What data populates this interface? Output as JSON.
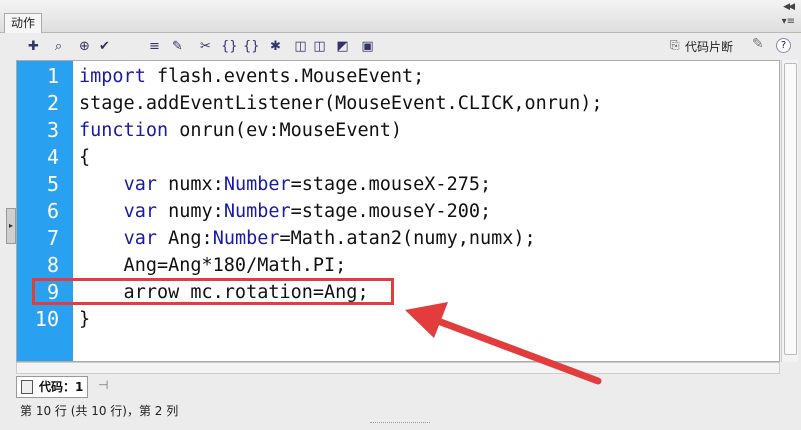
{
  "panel": {
    "tab_label": "动作"
  },
  "toolbar": {
    "icons": [
      "add-script-item-icon",
      "find-icon",
      "target-icon",
      "check-syntax-icon",
      "auto-format-icon",
      "code-hint-icon",
      "debug-options-icon",
      "collapse-braces-icon",
      "collapse-selection-icon",
      "expand-all-icon",
      "apply-block-comment-icon",
      "apply-line-comment-icon",
      "remove-comment-icon",
      "show-hide-toolbox-icon"
    ],
    "snippet_label": "代码片断"
  },
  "editor": {
    "line_numbers": [
      "1",
      "2",
      "3",
      "4",
      "5",
      "6",
      "7",
      "8",
      "9",
      "10"
    ],
    "lines": [
      [
        {
          "t": "import",
          "c": "kw"
        },
        {
          "t": " flash.events.MouseEvent;",
          "c": ""
        }
      ],
      [
        {
          "t": "stage.addEventListener(MouseEvent.CLICK,onrun);",
          "c": ""
        }
      ],
      [
        {
          "t": "function",
          "c": "kw"
        },
        {
          "t": " onrun(ev:MouseEvent)",
          "c": ""
        }
      ],
      [
        {
          "t": "{",
          "c": ""
        }
      ],
      [
        {
          "t": "    ",
          "c": ""
        },
        {
          "t": "var",
          "c": "kw"
        },
        {
          "t": " numx:",
          "c": ""
        },
        {
          "t": "Number",
          "c": "ty"
        },
        {
          "t": "=stage.mouseX-275;",
          "c": ""
        }
      ],
      [
        {
          "t": "    ",
          "c": ""
        },
        {
          "t": "var",
          "c": "kw"
        },
        {
          "t": " numy:",
          "c": ""
        },
        {
          "t": "Number",
          "c": "ty"
        },
        {
          "t": "=stage.mouseY-200;",
          "c": ""
        }
      ],
      [
        {
          "t": "    ",
          "c": ""
        },
        {
          "t": "var",
          "c": "kw"
        },
        {
          "t": " Ang:",
          "c": ""
        },
        {
          "t": "Number",
          "c": "ty"
        },
        {
          "t": "=Math.atan2(numy,numx);",
          "c": ""
        }
      ],
      [
        {
          "t": "    Ang=Ang*180/Math.PI;",
          "c": ""
        }
      ],
      [
        {
          "t": "    arrow_mc.rotation=Ang;",
          "c": ""
        }
      ],
      [
        {
          "t": "}",
          "c": ""
        }
      ]
    ]
  },
  "bottom_tab": {
    "label": "代码：1"
  },
  "status": {
    "text": "第 10 行 (共 10 行)，第 2 列"
  },
  "colors": {
    "gutter": "#2aa0f0",
    "keyword": "#1a1aa6",
    "annotation": "#e23c3c"
  }
}
